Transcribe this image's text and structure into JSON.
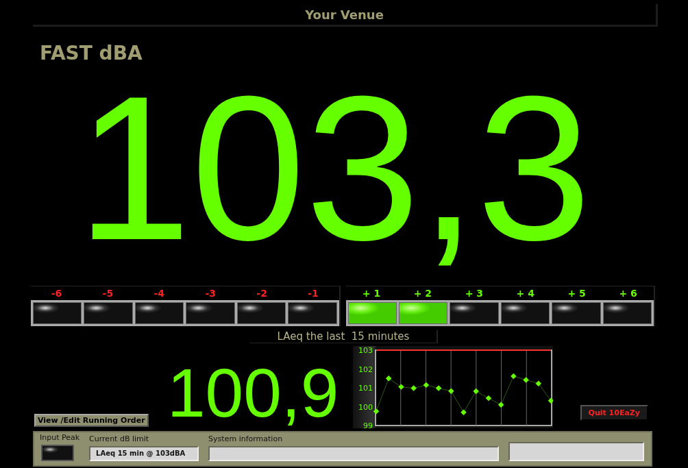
{
  "header": {
    "title": "Your Venue"
  },
  "main_reading": {
    "label": "FAST dBA",
    "value": "103,3"
  },
  "deviation_lamps": [
    {
      "label": "-6",
      "on": false,
      "color": "#ff2020"
    },
    {
      "label": "-5",
      "on": false,
      "color": "#ff2020"
    },
    {
      "label": "-4",
      "on": false,
      "color": "#ff2020"
    },
    {
      "label": "-3",
      "on": false,
      "color": "#ff2020"
    },
    {
      "label": "-2",
      "on": false,
      "color": "#ff2020"
    },
    {
      "label": "-1",
      "on": false,
      "color": "#ff2020"
    },
    {
      "label": "+ 1",
      "on": true,
      "color": "#66ff00"
    },
    {
      "label": "+ 2",
      "on": true,
      "color": "#66ff00"
    },
    {
      "label": "+ 3",
      "on": false,
      "color": "#66ff00"
    },
    {
      "label": "+ 4",
      "on": false,
      "color": "#66ff00"
    },
    {
      "label": "+ 5",
      "on": false,
      "color": "#66ff00"
    },
    {
      "label": "+ 6",
      "on": false,
      "color": "#66ff00"
    }
  ],
  "laeq": {
    "title": "LAeq the last  15 minutes",
    "value": "100,9",
    "chart_data": {
      "type": "line",
      "ylim": [
        99,
        103
      ],
      "yticks": [
        99,
        100,
        101,
        102,
        103
      ],
      "grid": true,
      "series": [
        {
          "color": "#66ff00",
          "marker": "diamond",
          "values": [
            99.75,
            101.5,
            101.05,
            100.98,
            101.15,
            100.98,
            100.83,
            99.7,
            100.82,
            100.45,
            100.1,
            101.62,
            101.42,
            101.23,
            100.32
          ]
        },
        {
          "color": "#ff3030",
          "values": [
            103,
            103,
            103,
            103,
            103,
            103,
            103,
            103,
            103,
            103,
            103,
            103,
            103,
            103,
            103
          ]
        }
      ]
    }
  },
  "buttons": {
    "running_order": "View /Edit Running Order",
    "quit": "Quit 10EaZy"
  },
  "status_panel": {
    "input_peak": {
      "label": "Input Peak",
      "on": false
    },
    "current_limit": {
      "label": "Current dB limit",
      "value": "LAeq 15 min @ 103dBA"
    },
    "system_information": {
      "label": "System information"
    }
  }
}
